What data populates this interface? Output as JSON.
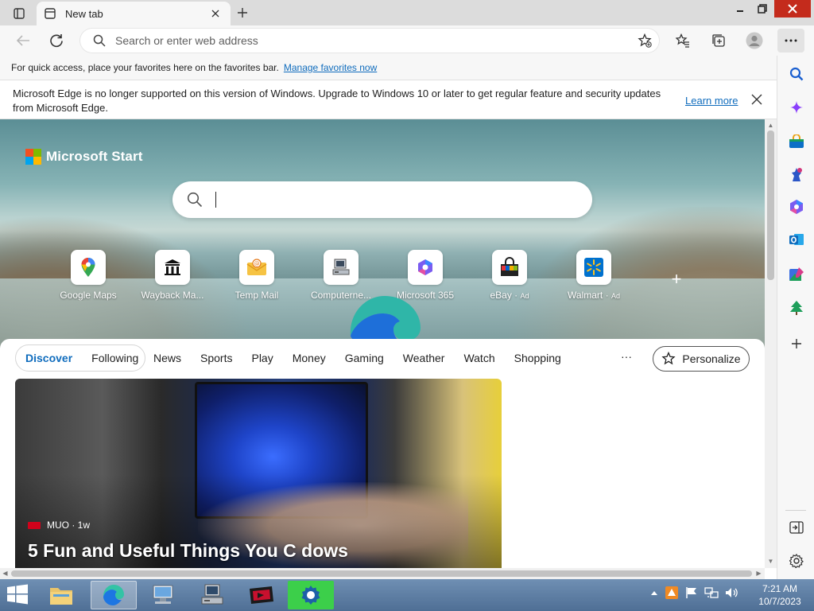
{
  "tab": {
    "title": "New tab"
  },
  "address": {
    "placeholder": "Search or enter web address"
  },
  "favorites_bar": {
    "message": "For quick access, place your favorites here on the favorites bar.",
    "link": "Manage favorites now"
  },
  "infobar": {
    "message": "Microsoft Edge is no longer supported on this version of Windows. Upgrade to Windows 10 or later to get regular feature and security updates from Microsoft Edge.",
    "learn_more": "Learn more"
  },
  "hero": {
    "brand": "Microsoft Start",
    "tiles": [
      {
        "label": "Google Maps",
        "ad": "",
        "icon": "google-maps-icon"
      },
      {
        "label": "Wayback Ma...",
        "ad": "",
        "icon": "wayback-machine-icon"
      },
      {
        "label": "Temp Mail",
        "ad": "",
        "icon": "temp-mail-icon"
      },
      {
        "label": "Computerne...",
        "ad": "",
        "icon": "computer-icon"
      },
      {
        "label": "Microsoft 365",
        "ad": "",
        "icon": "microsoft-365-icon"
      },
      {
        "label": "eBay",
        "ad": "Ad",
        "icon": "ebay-icon"
      },
      {
        "label": "Walmart",
        "ad": "Ad",
        "icon": "walmart-icon"
      }
    ]
  },
  "feed": {
    "pill": [
      "Discover",
      "Following"
    ],
    "categories": [
      "News",
      "Sports",
      "Play",
      "Money",
      "Gaming",
      "Weather",
      "Watch",
      "Shopping"
    ],
    "more": "···",
    "personalize": "Personalize",
    "card": {
      "source": "MUO · 1w",
      "headline": "5 Fun and Useful Things You C          dows"
    }
  },
  "taskbar": {
    "time": "7:21 AM",
    "date": "10/7/2023"
  },
  "colors": {
    "accent": "#0f6cbd",
    "close_red": "#c42b1c",
    "taskbar": "#5a7aa1"
  }
}
